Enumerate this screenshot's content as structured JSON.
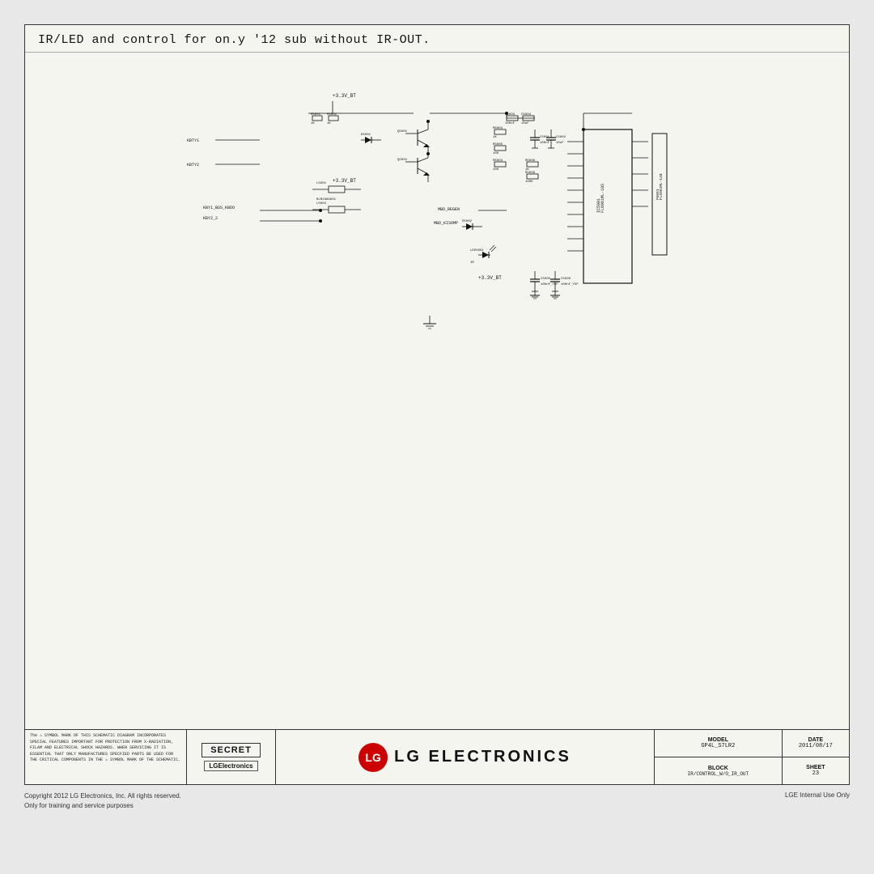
{
  "page": {
    "background_color": "#e8e8e8"
  },
  "sheet": {
    "title": "IR/LED  and  control  for  on.y  '12  sub  without  IR-OUT.",
    "border_color": "#333"
  },
  "footer": {
    "warning_text": "The ⚠ SYMBOL MARK OF THIS SCHEMATIC DIAGRAM INCORPORATES SPECIAL FEATURES IMPORTANT FOR PROTECTION FROM X-RADIATION, FILAM AND ELECTRICAL SHOCK HAZARDS. WHEN SERVICING IT IS ESSENTIAL THAT ONLY MANUFACTURES SPECFIED PARTS BE USED FOR THE CRITICAL COMPONENTS IN THE ⚠ SYMBOL MARK OF THE SCHEMATIC.",
    "secret_label": "SECRET",
    "brand_label": "LGElectronics",
    "lg_logo_text": "LG ELECTRONICS",
    "model_label": "MODEL",
    "model_value": "GP4L_S7LR2",
    "date_label": "DATE",
    "date_value": "2011/08/17",
    "block_label": "BLOCK",
    "block_value": "IR/CONTROL_W/O_IR_OUT",
    "sheet_label": "SHEET",
    "sheet_value": "23"
  },
  "credits": {
    "left": "Copyright 2012 LG Electronics, Inc. All rights reserved.\nOnly for training and service purposes",
    "right": "LGE Internal Use Only"
  }
}
